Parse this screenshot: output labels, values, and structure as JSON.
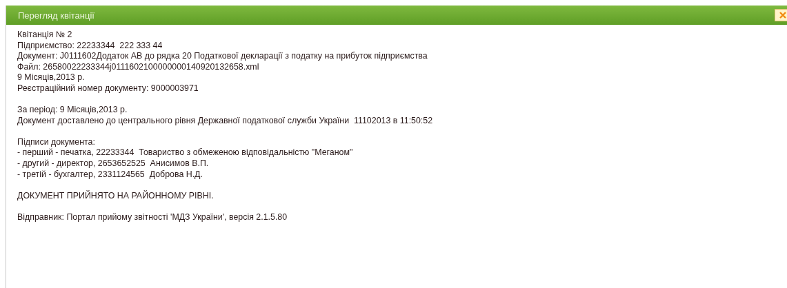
{
  "window": {
    "title": "Перегляд квітанції"
  },
  "blocks": [
    [
      "Квітанція № 2",
      "Підприємство: 22233344  222 333 44",
      "Документ: J0111602Додаток АВ до рядка 20 Податкової декларації з податку на прибуток підприємства",
      "Файл: 26580022233344j0111602100000000140920132658.xml",
      "9 Місяців,2013 р.",
      "Реєстраційний номер документу: 9000003971"
    ],
    [
      "За період: 9 Місяців,2013 р.",
      "Документ доставлено до центрального рівня Державної податкової служби України  11102013 в 11:50:52"
    ],
    [
      "Підписи документа:",
      "- перший - печатка, 22233344  Товариство з обмеженою відповідальністю \"Меганом\"",
      "- другий - директор, 2653652525  Анисимов В.П.",
      "- третій - бухгалтер, 2331124565  Доброва Н.Д."
    ],
    [
      "ДОКУМЕНТ ПРИЙНЯТО НА РАЙОННОМУ РІВНІ."
    ],
    [
      "Відправник: Портал прийому звітності 'МДЗ України', версія 2.1.5.80"
    ]
  ]
}
